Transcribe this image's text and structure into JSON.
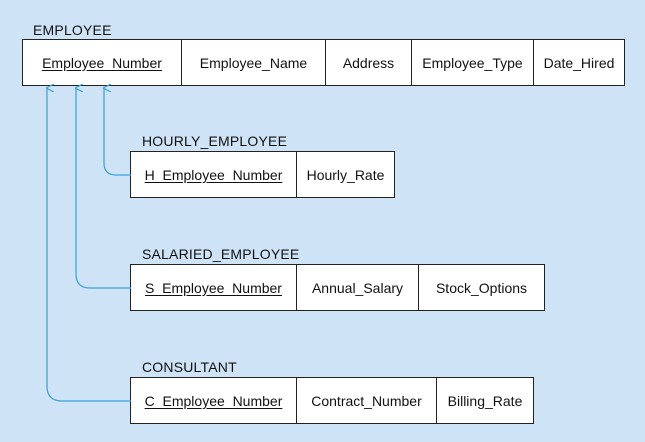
{
  "tables": {
    "employee": {
      "name": "EMPLOYEE",
      "columns": [
        "Employee_Number",
        "Employee_Name",
        "Address",
        "Employee_Type",
        "Date_Hired"
      ]
    },
    "hourly": {
      "name": "HOURLY_EMPLOYEE",
      "columns": [
        "H_Employee_Number",
        "Hourly_Rate"
      ]
    },
    "salaried": {
      "name": "SALARIED_EMPLOYEE",
      "columns": [
        "S_Employee_Number",
        "Annual_Salary",
        "Stock_Options"
      ]
    },
    "consultant": {
      "name": "CONSULTANT",
      "columns": [
        "C_Employee_Number",
        "Contract_Number",
        "Billing_Rate"
      ]
    }
  },
  "colors": {
    "background": "#cfe3f6",
    "connector": "#3aa0d8",
    "border": "#222222"
  }
}
